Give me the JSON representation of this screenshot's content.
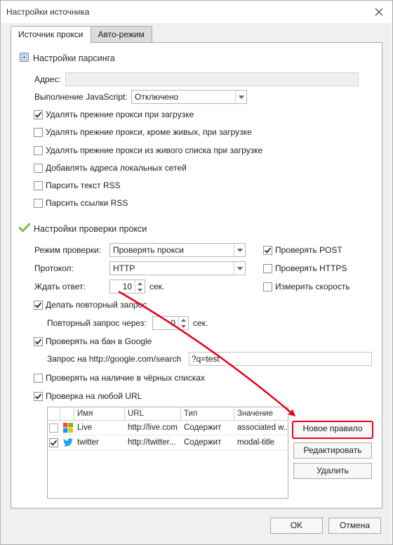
{
  "window": {
    "title": "Настройки источника"
  },
  "tabs": [
    {
      "label": "Источник прокси"
    },
    {
      "label": "Авто-режим"
    }
  ],
  "parsing": {
    "header": "Настройки парсинга",
    "address_label": "Адрес:",
    "address_value": "",
    "js_label": "Выполнение JavaScript:",
    "js_value": "Отключено",
    "options": [
      {
        "label": "Удалять прежние прокси при загрузке",
        "checked": true
      },
      {
        "label": "Удалять прежние прокси, кроме живых, при загрузке",
        "checked": false
      },
      {
        "label": "Удалять прежние прокси из живого списка при загрузке",
        "checked": false
      },
      {
        "label": "Добавлять адреса локальных сетей",
        "checked": false
      },
      {
        "label": "Парсить текст RSS",
        "checked": false
      },
      {
        "label": "Парсить ссылки RSS",
        "checked": false
      }
    ]
  },
  "check": {
    "header": "Настройки проверки прокси",
    "mode_label": "Режим проверки:",
    "mode_value": "Проверять прокси",
    "protocol_label": "Протокол:",
    "protocol_value": "HTTP",
    "wait_label": "Ждать ответ:",
    "wait_value": "10",
    "wait_unit": "сек.",
    "right_options": [
      {
        "label": "Проверять POST",
        "checked": true
      },
      {
        "label": "Проверять HTTPS",
        "checked": false
      },
      {
        "label": "Измерить скорость",
        "checked": false
      }
    ],
    "retry": {
      "label": "Делать повторный запрос",
      "checked": true
    },
    "retry_delay_label": "Повторный запрос через:",
    "retry_delay_value": "0",
    "retry_delay_unit": "сек.",
    "google_ban": {
      "label": "Проверять на бан в Google",
      "checked": true
    },
    "google_query_label": "Запрос на http://google.com/search",
    "google_query_value": "?q=test",
    "blacklists": {
      "label": "Проверять на наличие в чёрных списках",
      "checked": false
    },
    "any_url": {
      "label": "Проверка на любой URL",
      "checked": true
    }
  },
  "rules_table": {
    "columns": [
      "Имя",
      "URL",
      "Тип",
      "Значение"
    ],
    "rows": [
      {
        "checked": false,
        "icon": "windows-logo-icon",
        "name": "Live",
        "url": "http://live.com",
        "type": "Содержит",
        "value": "associated w..."
      },
      {
        "checked": true,
        "icon": "twitter-bird-icon",
        "name": "twitter",
        "url": "http://twitter...",
        "type": "Содержит",
        "value": "modal-title"
      }
    ]
  },
  "rule_buttons": {
    "new": "Новое правило",
    "edit": "Редактировать",
    "delete": "Удалить"
  },
  "footer": {
    "ok": "OK",
    "cancel": "Отмена"
  },
  "colors": {
    "annotation": "#e8001c",
    "checkmark": "#222222",
    "section_icon_green": "#7ac143",
    "twitter": "#1da1f2"
  }
}
